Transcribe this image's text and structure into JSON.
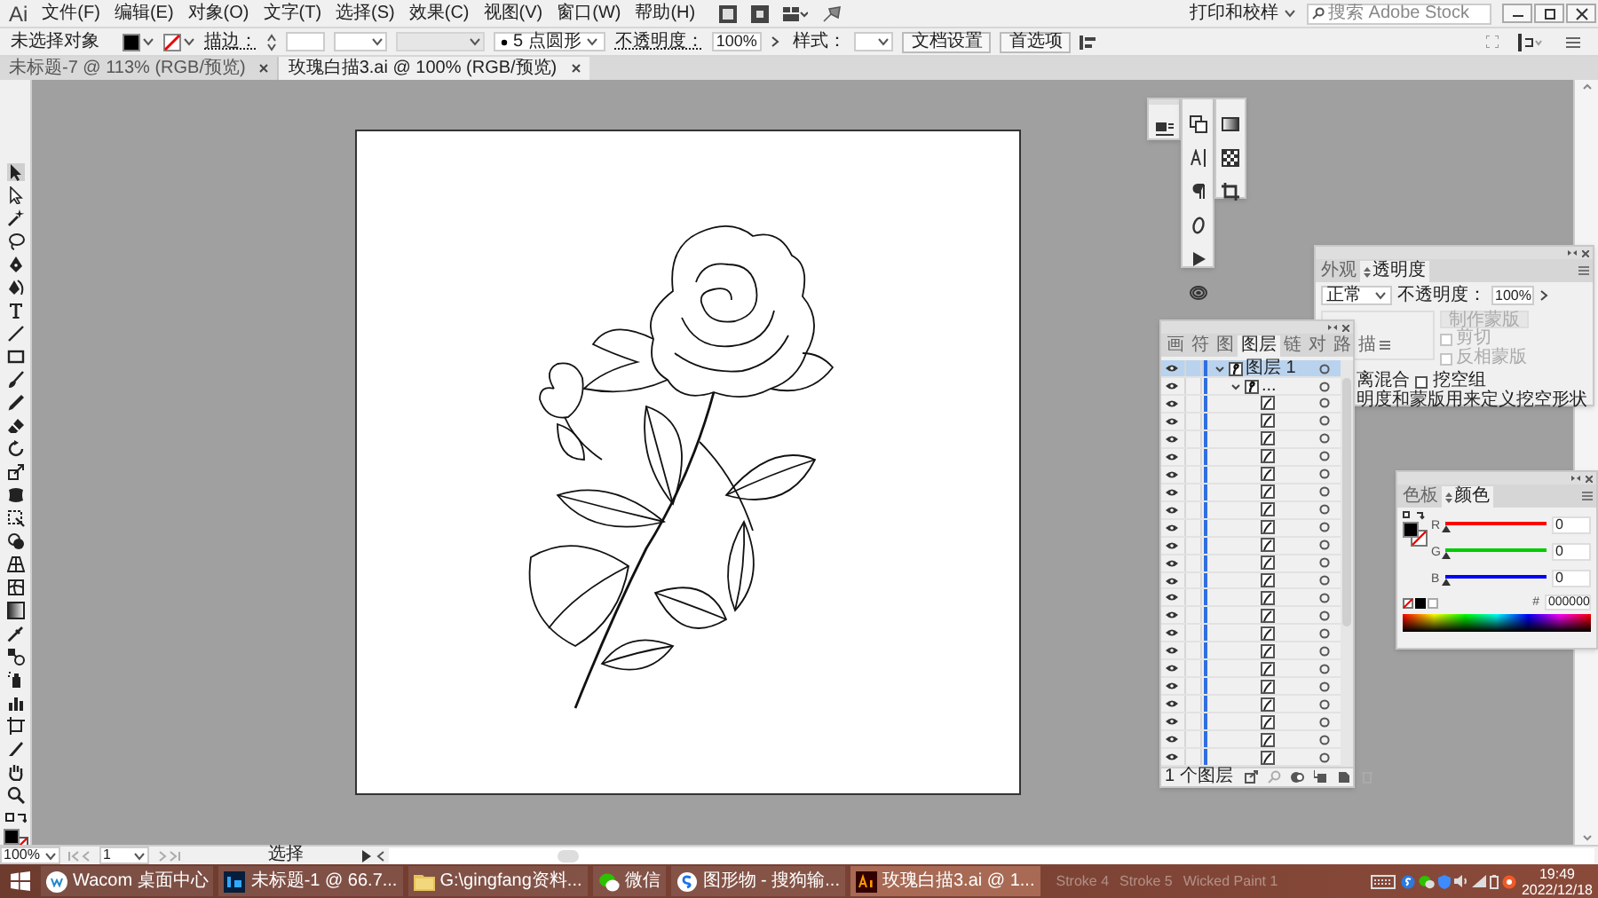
{
  "app_logo": "Ai",
  "menu": [
    "文件(F)",
    "编辑(E)",
    "对象(O)",
    "文字(T)",
    "选择(S)",
    "效果(C)",
    "视图(V)",
    "窗口(W)",
    "帮助(H)"
  ],
  "workspace": "打印和校样",
  "search": {
    "placeholder": "搜索 Adobe Stock"
  },
  "control_bar": {
    "selection": "未选择对象",
    "stroke_label": "描边：",
    "brush": "5 点圆形",
    "opacity_label": "不透明度：",
    "opacity": "100%",
    "style_label": "样式：",
    "buttons": [
      "文档设置",
      "首选项"
    ]
  },
  "tabs": [
    {
      "label": "未标题-7 @ 113% (RGB/预览)",
      "selected": false
    },
    {
      "label": "玫瑰白描3.ai @ 100% (RGB/预览)",
      "selected": true
    }
  ],
  "transparency_panel": {
    "tabs": [
      {
        "label": "外观",
        "selected": false
      },
      {
        "label": "透明度",
        "selected": true
      }
    ],
    "mode": "正常",
    "opacity_label": "不透明度：",
    "opacity": "100%",
    "make_mask": {
      "label": "制作蒙版",
      "disabled": true
    },
    "mask_options": [
      {
        "label": "剪切",
        "checked": false,
        "disabled": true
      },
      {
        "label": "反相蒙版",
        "checked": false,
        "disabled": true
      }
    ],
    "partial_label": "离混合",
    "knockout": {
      "label": "挖空组",
      "checked": false
    },
    "note": "明度和蒙版用来定义挖空形状"
  },
  "layers_panel": {
    "tabs": [
      {
        "label": "画",
        "selected": false
      },
      {
        "label": "符",
        "selected": false
      },
      {
        "label": "图",
        "selected": false
      },
      {
        "label": "图层",
        "selected": true
      },
      {
        "label": "链",
        "selected": false
      },
      {
        "label": "对",
        "selected": false
      },
      {
        "label": "路",
        "selected": false
      },
      {
        "label": "描",
        "selected": false
      }
    ],
    "layers": [
      {
        "name": "图层 1",
        "selected": true,
        "expanded": true,
        "children": [
          {
            "name": "...",
            "selected": false,
            "expanded": true,
            "children": [
              {
                "kind": "path"
              },
              {
                "kind": "path"
              },
              {
                "kind": "path"
              },
              {
                "kind": "path"
              },
              {
                "kind": "path"
              },
              {
                "kind": "path"
              },
              {
                "kind": "path"
              },
              {
                "kind": "path"
              },
              {
                "kind": "path"
              },
              {
                "kind": "path"
              },
              {
                "kind": "path"
              },
              {
                "kind": "path"
              },
              {
                "kind": "path"
              },
              {
                "kind": "path"
              },
              {
                "kind": "path"
              },
              {
                "kind": "path"
              },
              {
                "kind": "path"
              },
              {
                "kind": "path"
              },
              {
                "kind": "path"
              },
              {
                "kind": "path"
              },
              {
                "kind": "path"
              }
            ]
          }
        ]
      }
    ],
    "footer": "1 个图层"
  },
  "color_panel": {
    "tabs": [
      {
        "label": "色板",
        "selected": false
      },
      {
        "label": "颜色",
        "selected": true
      }
    ],
    "channels": [
      {
        "name": "R",
        "color": "#ff0000",
        "level": 0,
        "value": "0"
      },
      {
        "name": "G",
        "color": "#00cc00",
        "level": 0,
        "value": "0"
      },
      {
        "name": "B",
        "color": "#0000ff",
        "level": 0,
        "value": "0"
      }
    ],
    "hex_label": "#",
    "hex": "000000"
  },
  "status_bar": {
    "zoom": "100%",
    "artboard": "1",
    "tool": "选择"
  },
  "taskbar": {
    "items": [
      {
        "kind": "wacom",
        "label": "Wacom 桌面中心",
        "selected": false
      },
      {
        "kind": "photoshop",
        "label": "未标题-1 @ 66.7...",
        "selected": false
      },
      {
        "kind": "folder",
        "label": "G:\\gingfang资料...",
        "selected": false
      },
      {
        "kind": "wechat",
        "label": "微信",
        "selected": false
      },
      {
        "kind": "browser",
        "label": "图形物 - 搜狗输...",
        "selected": false
      },
      {
        "kind": "illustrator",
        "label": "玫瑰白描3.ai @ 1...",
        "selected": true
      }
    ],
    "background_labels": [
      "Stroke 4",
      "Stroke 5",
      "Wicked Paint 1"
    ],
    "time": "19:49",
    "date": "2022/12/18"
  }
}
